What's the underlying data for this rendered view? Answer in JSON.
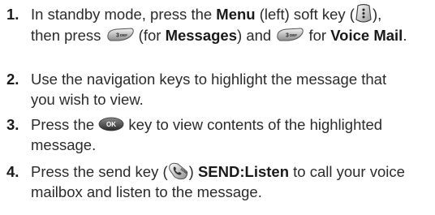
{
  "steps": [
    {
      "number": "1.",
      "line1_a": "In standby mode, press the ",
      "line1_b": "Menu",
      "line1_c": " (left) soft key (",
      "line1_d": "),",
      "line2_a": "then press ",
      "line2_b": " (for ",
      "line2_c": "Messages",
      "line2_d": ") and ",
      "line2_e": " for ",
      "line2_f": "Voice Mail",
      "line2_g": "."
    },
    {
      "number": "2.",
      "line1": "Use the navigation keys to highlight the message that",
      "line2": "you wish to view."
    },
    {
      "number": "3.",
      "line1_a": "Press the ",
      "line1_b": " key to view contents of the highlighted",
      "line2": "message."
    },
    {
      "number": "4.",
      "line1_a": "Press the send key (",
      "line1_b": ") ",
      "line1_c": "SEND:Listen",
      "line1_d": " to call your voice",
      "line2": "mailbox and listen to the message."
    }
  ],
  "keys": {
    "menu_key": "menu-soft-key-icon",
    "three_key_label": "3 DEF",
    "ok_key_label": "OK",
    "send_key_label": "SEND"
  }
}
